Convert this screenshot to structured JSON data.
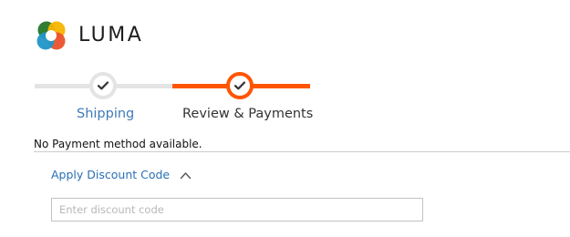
{
  "brand": {
    "name": "LUMA",
    "logo_colors": [
      "#2f7d32",
      "#f7b500",
      "#e8522c",
      "#2196c8"
    ]
  },
  "progress": {
    "active_color": "#ff5501",
    "inactive_color": "#e4e4e4",
    "steps": [
      {
        "label": "Shipping",
        "state": "complete",
        "icon": "check-icon"
      },
      {
        "label": "Review & Payments",
        "state": "active",
        "icon": "check-icon"
      }
    ]
  },
  "payment": {
    "notice": "No Payment method available."
  },
  "discount": {
    "toggle_label": "Apply Discount Code",
    "expanded": true,
    "toggle_icon": "chevron-up-icon",
    "input_value": "",
    "input_placeholder": "Enter discount code"
  }
}
